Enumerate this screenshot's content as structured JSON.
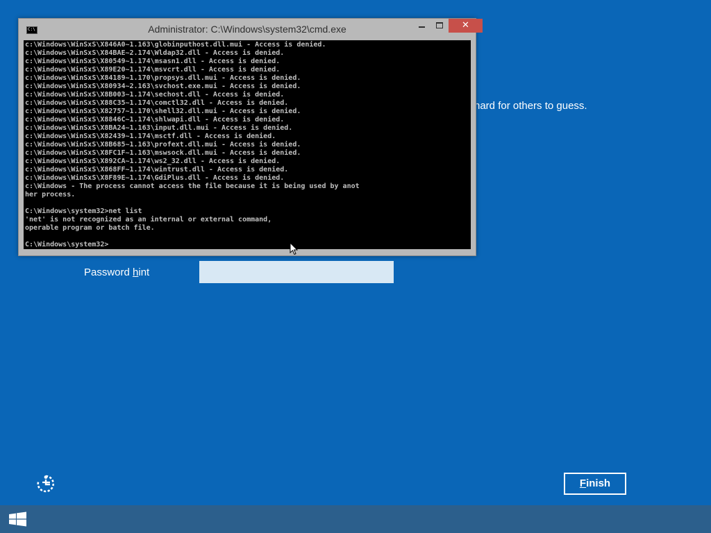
{
  "setup_page": {
    "hint_tail_text": "hard for others to guess.",
    "password_hint_label_prefix": "Password ",
    "password_hint_label_accel": "h",
    "password_hint_label_suffix": "int",
    "password_hint_value": "",
    "finish_label_accel": "F",
    "finish_label_rest": "inish"
  },
  "cmd_window": {
    "title": "Administrator: C:\\Windows\\system32\\cmd.exe",
    "icon_text": "C:\\",
    "close_glyph": "✕",
    "lines": [
      "c:\\Windows\\WinSxS\\X846A0~1.163\\globinputhost.dll.mui - Access is denied.",
      "c:\\Windows\\WinSxS\\X84BAE~2.174\\Wldap32.dll - Access is denied.",
      "c:\\Windows\\WinSxS\\X80549~1.174\\msasn1.dll - Access is denied.",
      "c:\\Windows\\WinSxS\\X89E20~1.174\\msvcrt.dll - Access is denied.",
      "c:\\Windows\\WinSxS\\X84189~1.170\\propsys.dll.mui - Access is denied.",
      "c:\\Windows\\WinSxS\\X80934~2.163\\svchost.exe.mui - Access is denied.",
      "c:\\Windows\\WinSxS\\X8B003~1.174\\sechost.dll - Access is denied.",
      "c:\\Windows\\WinSxS\\X88C35~1.174\\comctl32.dll - Access is denied.",
      "c:\\Windows\\WinSxS\\X82757~1.170\\shell32.dll.mui - Access is denied.",
      "c:\\Windows\\WinSxS\\X8846C~1.174\\shlwapi.dll - Access is denied.",
      "c:\\Windows\\WinSxS\\X8BA24~1.163\\input.dll.mui - Access is denied.",
      "c:\\Windows\\WinSxS\\X82439~1.174\\msctf.dll - Access is denied.",
      "c:\\Windows\\WinSxS\\X8B685~1.163\\profext.dll.mui - Access is denied.",
      "c:\\Windows\\WinSxS\\X8FC1F~1.163\\mswsock.dll.mui - Access is denied.",
      "c:\\Windows\\WinSxS\\X892CA~1.174\\ws2_32.dll - Access is denied.",
      "c:\\Windows\\WinSxS\\X868FF~1.174\\wintrust.dll - Access is denied.",
      "c:\\Windows\\WinSxS\\X8F89E~1.174\\GdiPlus.dll - Access is denied.",
      "c:\\Windows - The process cannot access the file because it is being used by anot",
      "her process.",
      "",
      "C:\\Windows\\system32>net list",
      "'net' is not recognized as an internal or external command,",
      "operable program or batch file.",
      "",
      "C:\\Windows\\system32>"
    ]
  },
  "colors": {
    "desktop_background": "#0a66b7",
    "taskbar": "#2c5f8c",
    "close_button": "#c7504a",
    "console_text": "#c0c0c0"
  },
  "icons": {
    "ease_of_access": "ease-of-access-icon",
    "start": "windows-logo-icon",
    "cursor": "mouse-pointer-icon"
  }
}
